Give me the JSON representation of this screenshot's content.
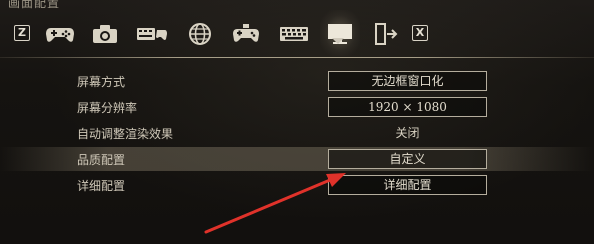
{
  "screen": {
    "title": "画面配置"
  },
  "tabbar": {
    "left_key": "Z",
    "right_key": "X",
    "tabs": [
      {
        "icon": "gamepad-icon"
      },
      {
        "icon": "camera-icon"
      },
      {
        "icon": "keyboard-controller-icon"
      },
      {
        "icon": "globe-icon"
      },
      {
        "icon": "robot-controller-icon"
      },
      {
        "icon": "keyboard-icon"
      },
      {
        "icon": "monitor-icon",
        "active": true
      },
      {
        "icon": "exit-door-icon"
      }
    ]
  },
  "settings": {
    "rows": [
      {
        "label": "屏幕方式",
        "value": "无边框窗口化",
        "style": "box"
      },
      {
        "label": "屏幕分辨率",
        "value": "1920 × 1080",
        "style": "box"
      },
      {
        "label": "自动调整渲染效果",
        "value": "关闭",
        "style": "plain"
      },
      {
        "label": "品质配置",
        "value": "自定义",
        "style": "box",
        "highlighted": true
      },
      {
        "label": "详细配置",
        "value": "详细配置",
        "style": "box"
      }
    ]
  },
  "annotation": {
    "arrow_color": "#e0322a"
  },
  "colors": {
    "background": "#141210",
    "text": "#cfc8b8",
    "value_border": "#b4ad9d",
    "highlight": "#6e6656"
  }
}
